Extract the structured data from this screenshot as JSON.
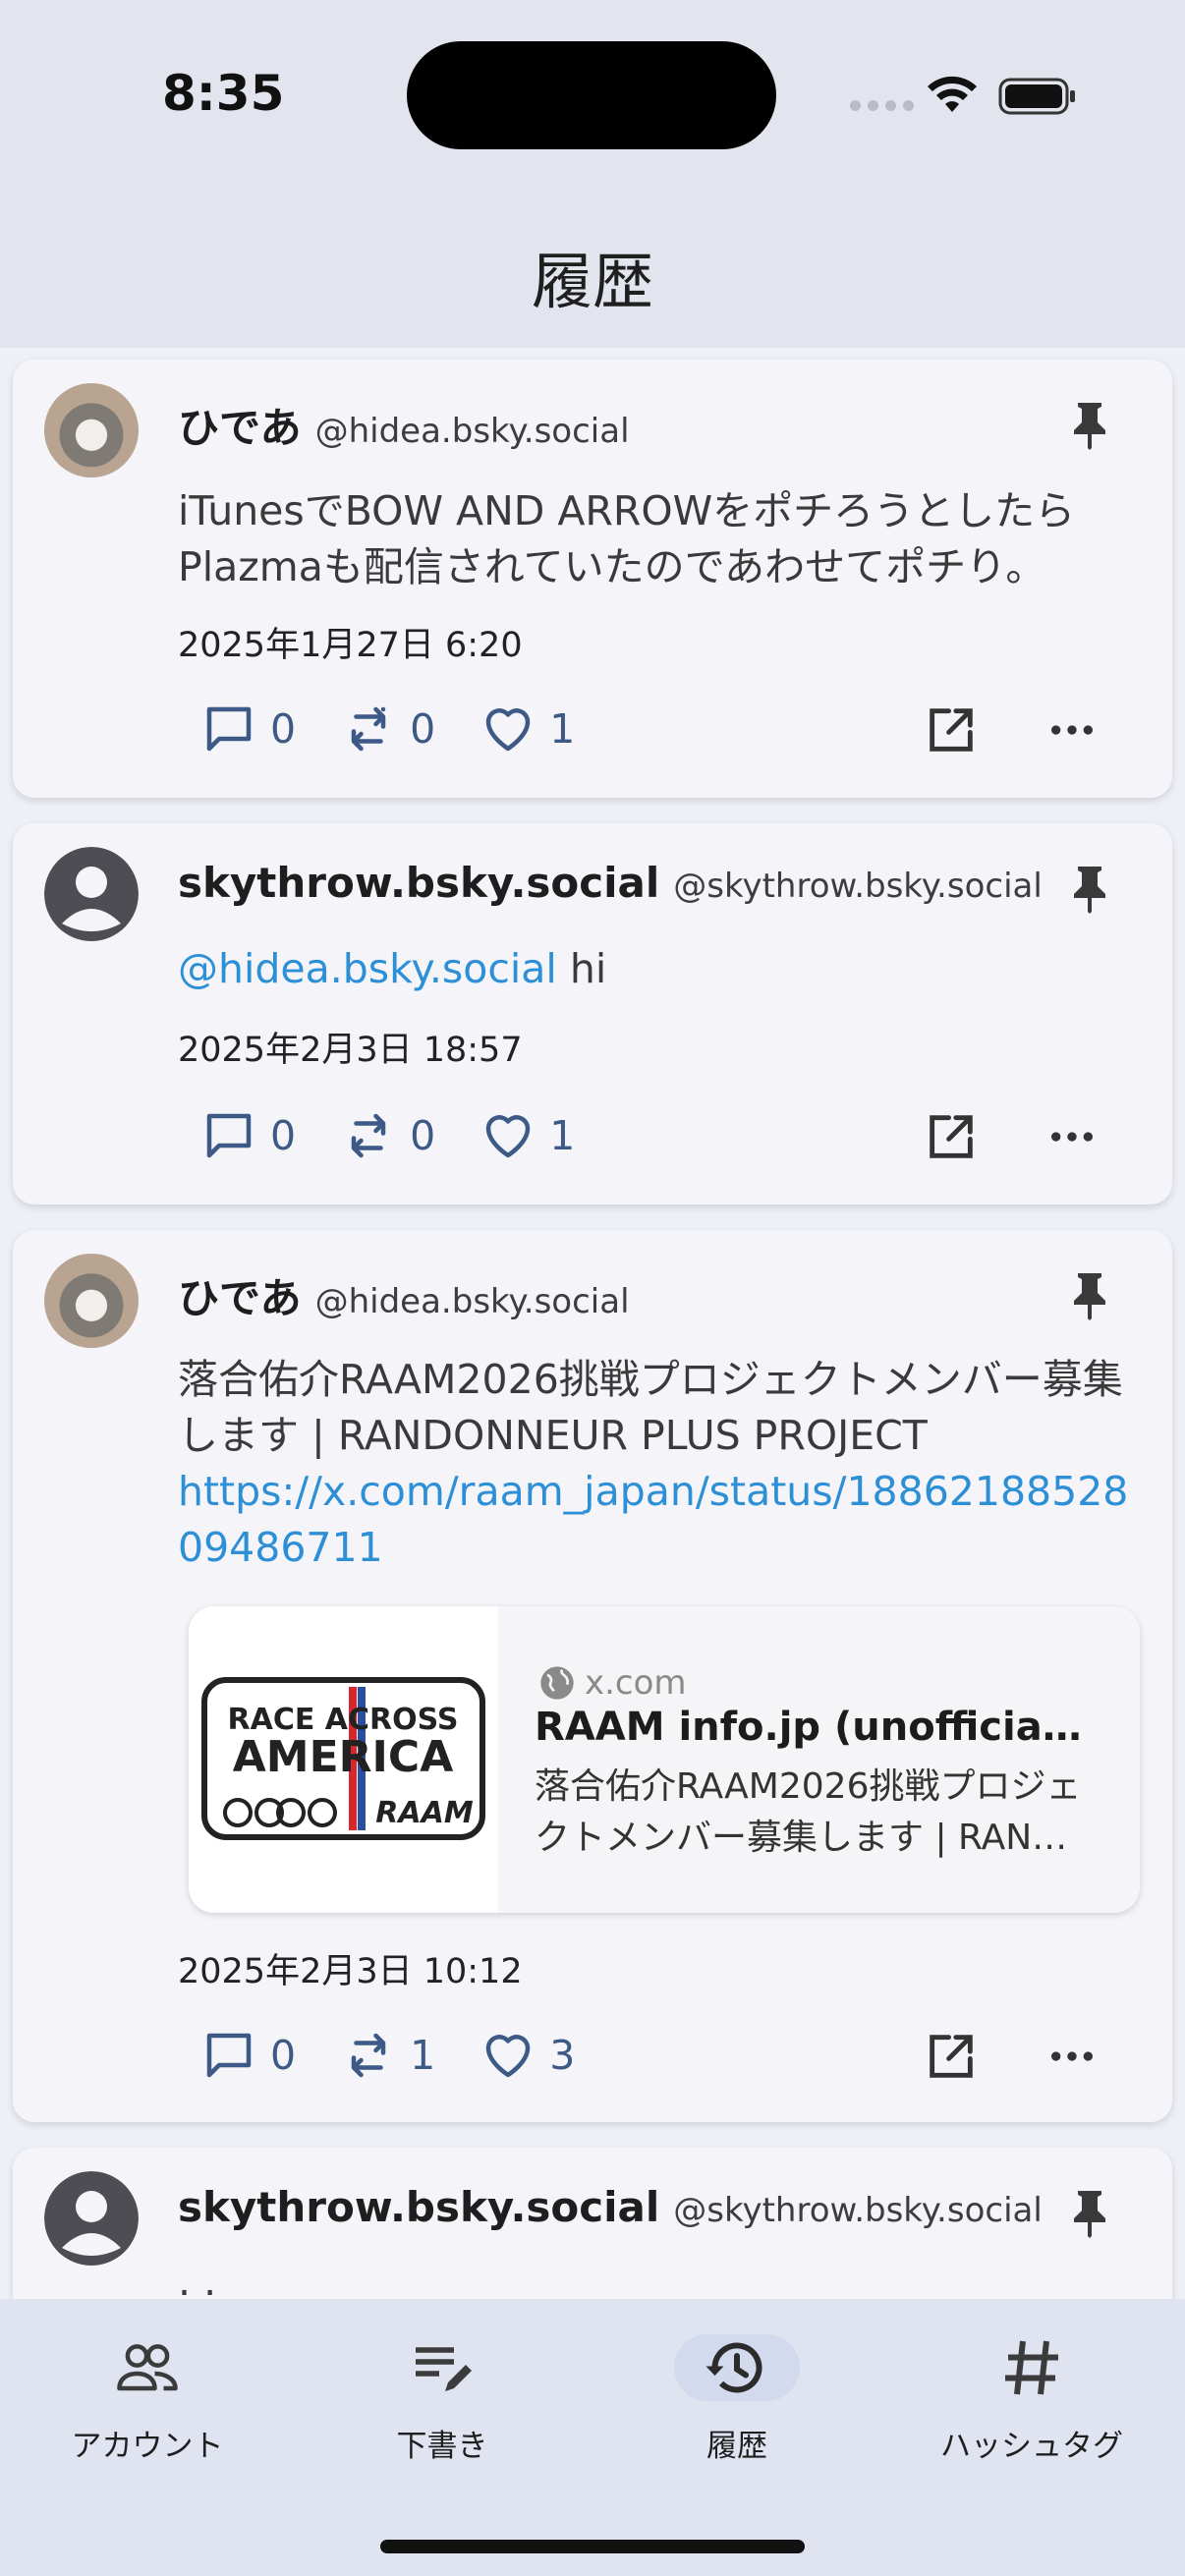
{
  "status_bar": {
    "time": "8:35"
  },
  "header": {
    "title": "履歴"
  },
  "posts": [
    {
      "display_name": "ひであ",
      "handle": "@hidea.bsky.social",
      "text": "iTunesでBOW AND ARROWをポチろうとしたらPlazmaも配信されていたのであわせてポチり。",
      "date": "2025年1月27日 6:20",
      "replies": "0",
      "reposts": "0",
      "likes": "1"
    },
    {
      "display_name": "skythrow.bsky.social",
      "handle": "@skythrow.bsky.social",
      "mention": "@hidea.bsky.social",
      "text": " hi",
      "date": "2025年2月3日 18:57",
      "replies": "0",
      "reposts": "0",
      "likes": "1"
    },
    {
      "display_name": "ひであ",
      "handle": "@hidea.bsky.social",
      "text": "落合佑介RAAM2026挑戦プロジェクトメンバー募集します | RANDONNEUR PLUS PROJECT",
      "link": "https://x.com/raam_japan/status/1886218852809486711",
      "embed": {
        "host": "x.com",
        "title": "RAAM info.jp (unofficial) (…",
        "description": "落合佑介RAAM2026挑戦プロジェクトメンバー募集します | RAN…",
        "thumb_line1": "RACE ACROSS",
        "thumb_line2": "AMERICA",
        "thumb_line3": "RAAM"
      },
      "date": "2025年2月3日 10:12",
      "replies": "0",
      "reposts": "1",
      "likes": "3"
    },
    {
      "display_name": "skythrow.bsky.social",
      "handle": "@skythrow.bsky.social",
      "text": ". ."
    }
  ],
  "nav": [
    {
      "label": "アカウント",
      "icon": "people-icon"
    },
    {
      "label": "下書き",
      "icon": "edit-note-icon"
    },
    {
      "label": "履歴",
      "icon": "history-icon",
      "active": true
    },
    {
      "label": "ハッシュタグ",
      "icon": "hashtag-icon"
    }
  ],
  "colors": {
    "link": "#2d8fd5",
    "action": "#3d5a86",
    "card": "#f4f4f9",
    "nav_bg": "#dfe4f0"
  }
}
